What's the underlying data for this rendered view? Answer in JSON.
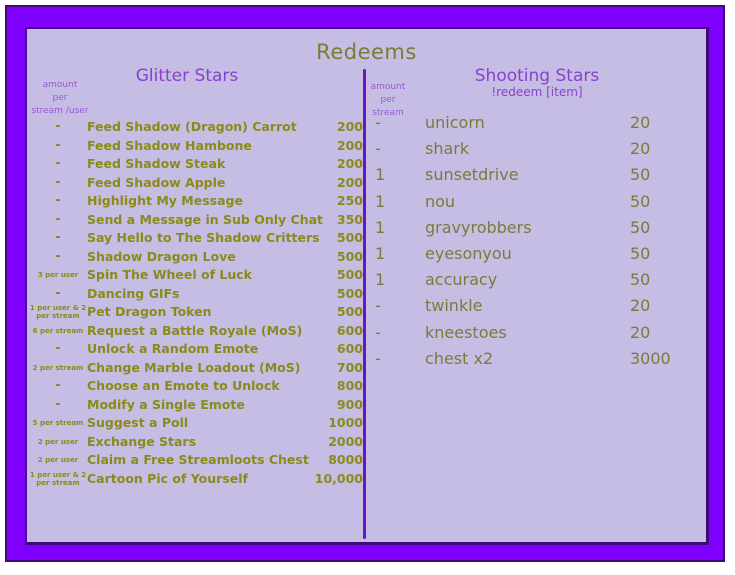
{
  "title": "Redeems",
  "colors": {
    "frame": "#8000ff",
    "panel": "#c6bde4",
    "heading": "#8a3fd0",
    "left_text": "#8a8a1a",
    "right_text": "#7a7a3a",
    "divider": "#6a14c8"
  },
  "glitter_stars": {
    "title": "Glitter Stars",
    "amount_header": [
      "amount",
      "per",
      "stream /user"
    ],
    "items": [
      {
        "amount": "-",
        "name": "Feed Shadow (Dragon) Carrot",
        "cost": "200"
      },
      {
        "amount": "-",
        "name": "Feed Shadow Hambone",
        "cost": "200"
      },
      {
        "amount": "-",
        "name": "Feed Shadow Steak",
        "cost": "200"
      },
      {
        "amount": "-",
        "name": "Feed Shadow Apple",
        "cost": "200"
      },
      {
        "amount": "-",
        "name": "Highlight My Message",
        "cost": "250"
      },
      {
        "amount": "-",
        "name": "Send a Message in Sub Only Chat",
        "cost": "350"
      },
      {
        "amount": "-",
        "name": "Say Hello to The Shadow Critters",
        "cost": "500"
      },
      {
        "amount": "-",
        "name": "Shadow Dragon Love",
        "cost": "500"
      },
      {
        "amount": "3 per user",
        "name": "Spin The Wheel of Luck",
        "cost": "500"
      },
      {
        "amount": "-",
        "name": "Dancing GIFs",
        "cost": "500"
      },
      {
        "amount": "1 per user & 2 per stream",
        "name": "Pet Dragon Token",
        "cost": "500"
      },
      {
        "amount": "6 per stream",
        "name": "Request a Battle Royale (MoS)",
        "cost": "600"
      },
      {
        "amount": "-",
        "name": "Unlock a Random Emote",
        "cost": "600"
      },
      {
        "amount": "2 per stream",
        "name": "Change Marble Loadout (MoS)",
        "cost": "700"
      },
      {
        "amount": "-",
        "name": "Choose an Emote to Unlock",
        "cost": "800"
      },
      {
        "amount": "-",
        "name": "Modify a Single Emote",
        "cost": "900"
      },
      {
        "amount": "5 per stream",
        "name": "Suggest a Poll",
        "cost": "1000"
      },
      {
        "amount": "2 per user",
        "name": "Exchange Stars",
        "cost": "2000"
      },
      {
        "amount": "2 per user",
        "name": "Claim a Free Streamloots Chest",
        "cost": "8000"
      },
      {
        "amount": "1 per user & 2 per stream",
        "name": "Cartoon Pic of Yourself",
        "cost": "10,000"
      }
    ]
  },
  "shooting_stars": {
    "title": "Shooting Stars",
    "subtitle": "!redeem [item]",
    "amount_header": [
      "amount",
      "per",
      "stream"
    ],
    "items": [
      {
        "amount": "-",
        "name": "unicorn",
        "cost": "20"
      },
      {
        "amount": "-",
        "name": "shark",
        "cost": "20"
      },
      {
        "amount": "1",
        "name": "sunsetdrive",
        "cost": "50"
      },
      {
        "amount": "1",
        "name": "nou",
        "cost": "50"
      },
      {
        "amount": "1",
        "name": "gravyrobbers",
        "cost": "50"
      },
      {
        "amount": "1",
        "name": "eyesonyou",
        "cost": "50"
      },
      {
        "amount": "1",
        "name": "accuracy",
        "cost": "50"
      },
      {
        "amount": "-",
        "name": "twinkle",
        "cost": "20"
      },
      {
        "amount": "-",
        "name": "kneestoes",
        "cost": "20"
      },
      {
        "amount": "-",
        "name": "chest x2",
        "cost": "3000"
      }
    ]
  }
}
